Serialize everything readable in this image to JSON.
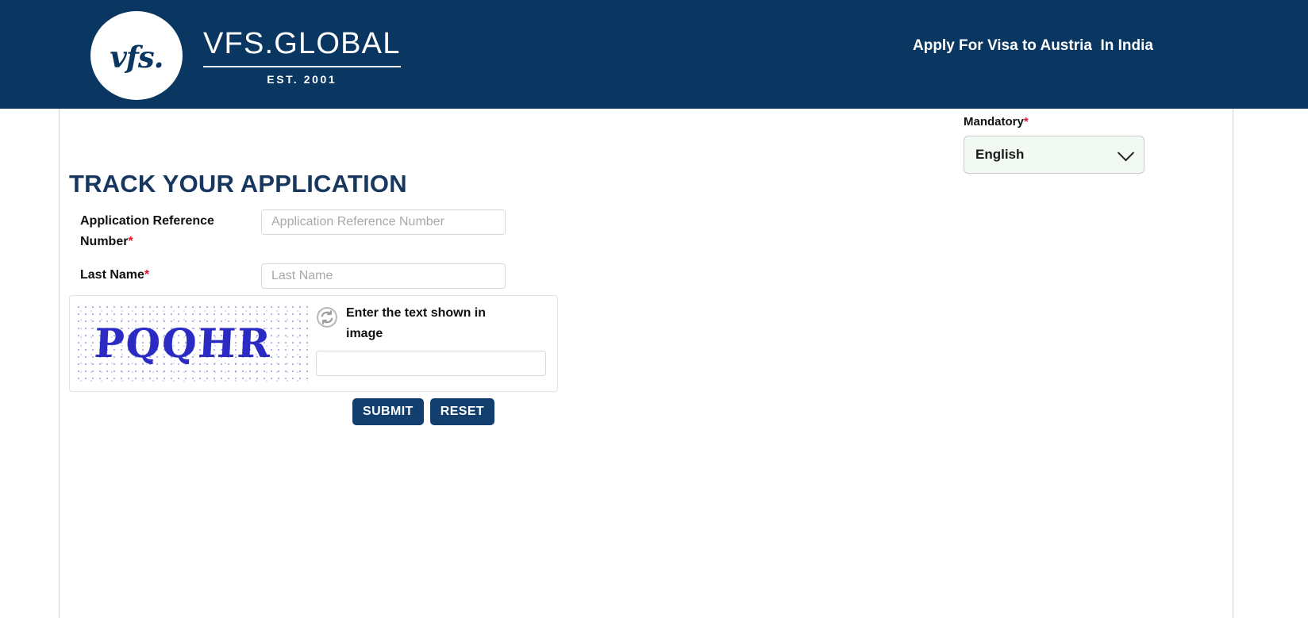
{
  "header": {
    "logo_mark": "vfs.",
    "logo_title": "VFS.GLOBAL",
    "logo_sub": "EST. 2001",
    "right_text": "Apply For Visa to Austria  In India",
    "bg_color": "#0a3761"
  },
  "language": {
    "mandatory_label": "Mandatory",
    "mandatory_star": "*",
    "selected": "English",
    "options": [
      "English"
    ],
    "chevron_icon": "chevron-down-icon"
  },
  "main": {
    "title": "TRACK YOUR APPLICATION",
    "title_color": "#17375e",
    "fields": [
      {
        "label": "Application Reference Number",
        "required_star": "*",
        "value": "",
        "placeholder": "Application Reference Number"
      },
      {
        "label": "Last Name",
        "required_star": "*",
        "value": "",
        "placeholder": "Last Name"
      }
    ],
    "captcha": {
      "image_text": "PQQHR",
      "refresh_icon": "refresh-icon",
      "hint": "Enter the text shown in image",
      "input_value": "",
      "input_placeholder": ""
    },
    "buttons": {
      "submit": "SUBMIT",
      "reset": "RESET",
      "color": "#123f6d"
    }
  }
}
